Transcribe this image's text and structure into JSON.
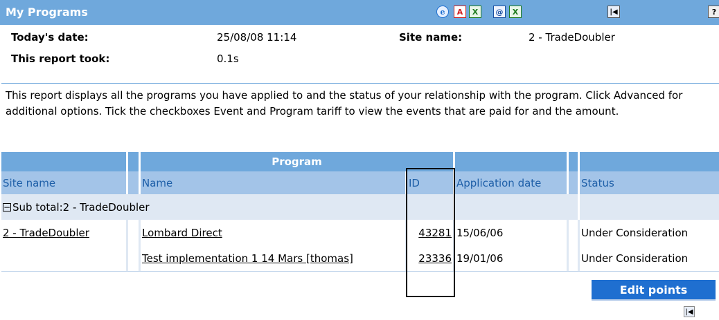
{
  "header": {
    "title": "My Programs",
    "icons": [
      "ie-icon",
      "pdf-icon",
      "excel-icon",
      "html-export-icon",
      "excel-export-icon",
      "first-page-icon",
      "help-icon"
    ],
    "help_label": "?"
  },
  "info": {
    "todays_date_label": "Today's date:",
    "todays_date_value": "25/08/08 11:14",
    "site_name_label": "Site name:",
    "site_name_value": "2 - TradeDoubler",
    "report_took_label": "This report took:",
    "report_took_value": "0.1s"
  },
  "description": "This report displays all the programs you have applied to and the status of your relationship with the program. Click Advanced for additional options. Tick the checkboxes Event and Program tariff to view the events that are paid for and the amount.",
  "table": {
    "group_header": "Program",
    "columns": [
      "Site name",
      "Name",
      "ID",
      "Application date",
      "Status"
    ],
    "subtotal_label": "Sub total:2 - TradeDoubler",
    "rows": [
      {
        "site": "2 - TradeDoubler",
        "name": "Lombard Direct",
        "id": "43281",
        "date": "15/06/06",
        "status": "Under Consideration"
      },
      {
        "site": "",
        "name": "Test implementation 1 14 Mars [thomas]",
        "id": "23336",
        "date": "19/01/06",
        "status": "Under Consideration"
      }
    ]
  },
  "buttons": {
    "edit_points": "Edit points"
  },
  "colors": {
    "header_bg": "#6fa8dc",
    "subheader_bg": "#a3c4e8",
    "subtotal_bg": "#dfe8f3",
    "button_bg": "#1f6fd0"
  }
}
